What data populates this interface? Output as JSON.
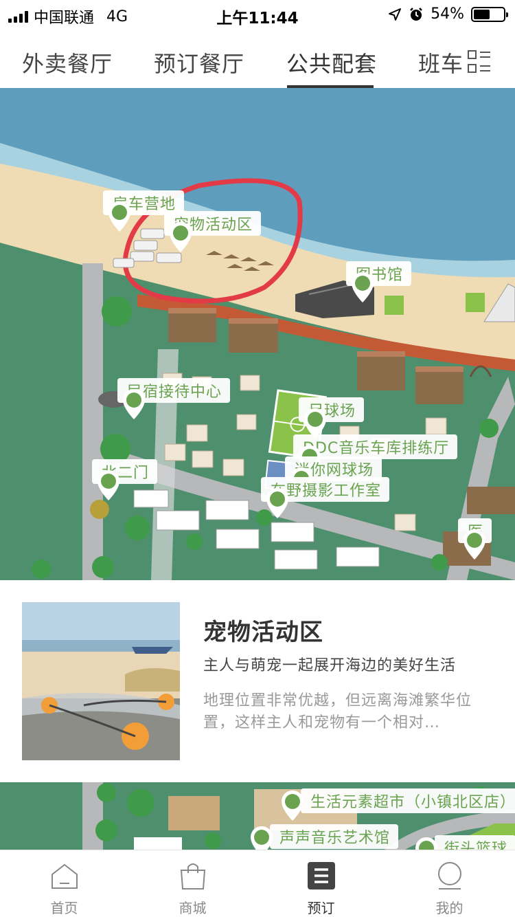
{
  "status_bar": {
    "carrier": "中国联通",
    "network": "4G",
    "time": "上午11:44",
    "battery": "54%",
    "battery_level": 0.54
  },
  "tabs": [
    {
      "label": "外卖餐厅",
      "active": false
    },
    {
      "label": "预订餐厅",
      "active": false
    },
    {
      "label": "公共配套",
      "active": true
    },
    {
      "label": "班车",
      "active": false
    }
  ],
  "tabs_menu_icon": "grid-menu-icon",
  "map": {
    "markers": [
      {
        "label": "房车营地"
      },
      {
        "label": "宠物活动区"
      },
      {
        "label": "图书馆"
      },
      {
        "label": "民宿接待中心"
      },
      {
        "label": "足球场"
      },
      {
        "label": "DDC音乐车库排练厅"
      },
      {
        "label": "北二门"
      },
      {
        "label": "迷你网球场"
      },
      {
        "label": "在野摄影工作室"
      },
      {
        "label": "医"
      }
    ]
  },
  "card": {
    "title": "宠物活动区",
    "subtitle": "主人与萌宠一起展开海边的美好生活",
    "description": "地理位置非常优越，但远离海滩繁华位置，这样主人和宠物有一个相对…"
  },
  "map2": {
    "markers": [
      {
        "label": "生活元素超市（小镇北区店）"
      },
      {
        "label": "声声音乐艺术馆"
      },
      {
        "label": "街头篮球"
      }
    ]
  },
  "bottom_nav": [
    {
      "label": "首页",
      "icon": "home-icon",
      "active": false
    },
    {
      "label": "商城",
      "icon": "shopping-bag-icon",
      "active": false
    },
    {
      "label": "预订",
      "icon": "booking-list-icon",
      "active": true
    },
    {
      "label": "我的",
      "icon": "profile-icon",
      "active": false
    }
  ],
  "colors": {
    "marker_green": "#6aa34f",
    "sea": "#5e9dbb",
    "sand": "#efdcb4",
    "grass": "#4e8f6e",
    "highlight_circle": "#e33a48"
  }
}
